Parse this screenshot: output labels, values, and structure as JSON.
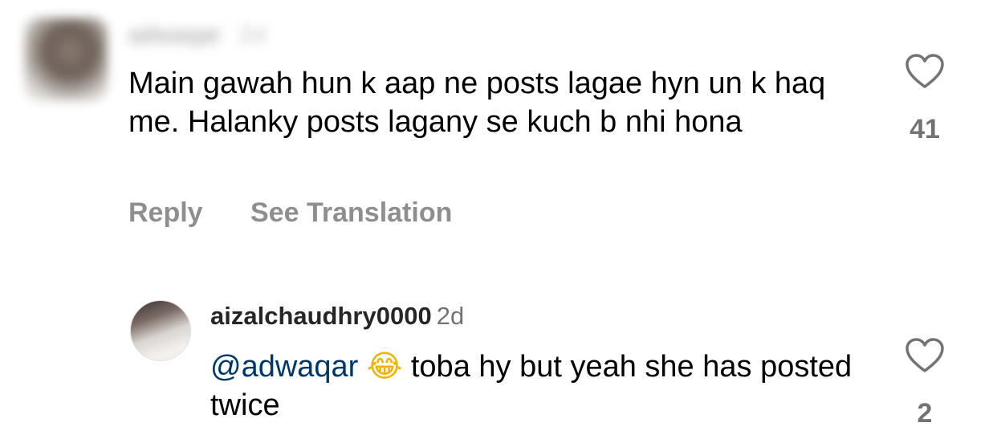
{
  "comment": {
    "username": "adwaqar",
    "time": "2d",
    "text": "Main gawah hun k aap ne posts lagae hyn un k haq me. Halanky posts lagany se kuch b nhi hona",
    "reply_label": "Reply",
    "translation_label": "See Translation",
    "like_count": "41"
  },
  "reply": {
    "username": "aizalchaudhry0000",
    "time": "2d",
    "mention": "@adwaqar",
    "emoji": "😂",
    "text": " toba hy but yeah she has posted twice",
    "like_count": "2"
  },
  "colors": {
    "mention": "#00376b",
    "secondary": "#8e8e8e"
  },
  "icons": {
    "like": "heart-outline-icon"
  }
}
